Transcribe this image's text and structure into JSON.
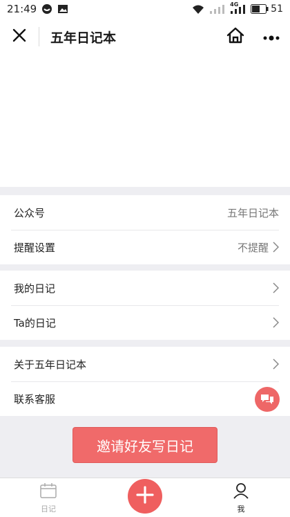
{
  "status_bar": {
    "time": "21:49",
    "network": "4G",
    "battery": "51",
    "icons": [
      "circle-app-icon",
      "image-notification-icon",
      "wifi-icon",
      "signal-icon",
      "signal-4g-icon",
      "battery-icon"
    ]
  },
  "nav": {
    "title": "五年日记本",
    "icons": [
      "close-icon",
      "home-icon",
      "more-icon"
    ]
  },
  "settings": {
    "group1": [
      {
        "label": "公众号",
        "value": "五年日记本"
      },
      {
        "label": "提醒设置",
        "value": "不提醒"
      }
    ],
    "group2": [
      {
        "label": "我的日记"
      },
      {
        "label": "Ta的日记"
      }
    ],
    "group3": [
      {
        "label": "关于五年日记本"
      },
      {
        "label": "联系客服"
      }
    ]
  },
  "invite_button": {
    "label": "邀请好友写日记"
  },
  "tab_bar": {
    "diary": "日记",
    "me": "我",
    "icons": [
      "calendar-icon",
      "plus-icon",
      "user-icon"
    ]
  },
  "colors": {
    "accent": "#f06a6a",
    "fab": "#ef5f5f",
    "background": "#eeeef2",
    "tab_inactive": "#a8a8a8"
  }
}
